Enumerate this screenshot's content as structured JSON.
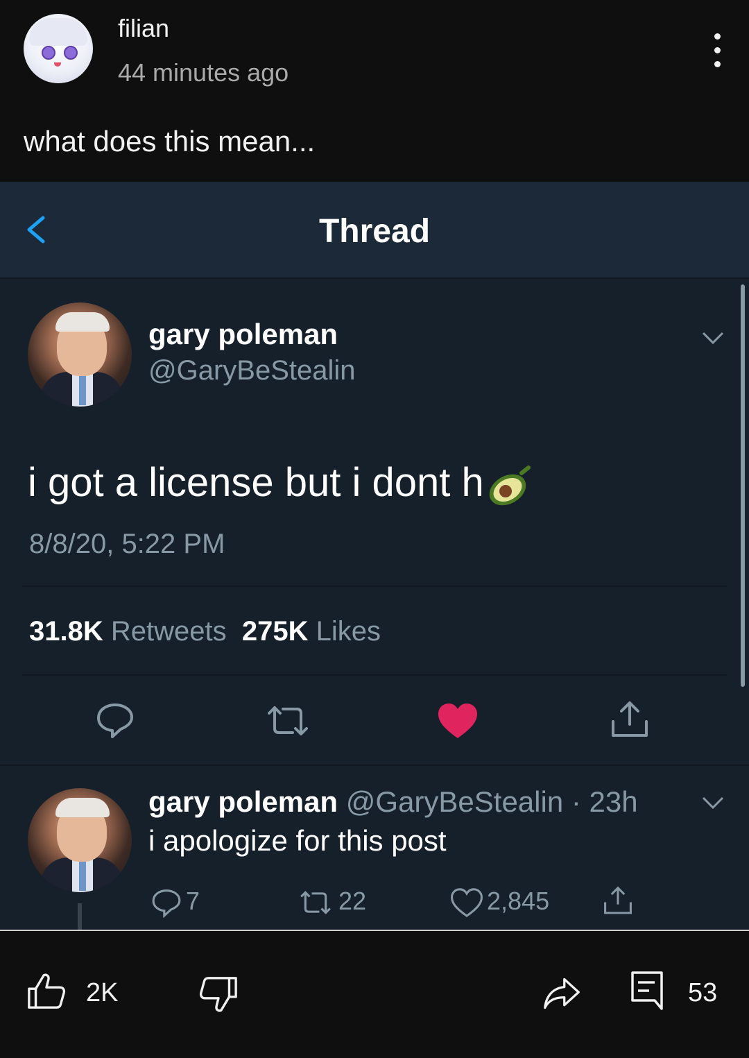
{
  "post": {
    "channel_name": "filian",
    "time_ago": "44 minutes ago",
    "text": "what does this mean..."
  },
  "thread": {
    "title": "Thread",
    "tweet": {
      "display_name": "gary poleman",
      "handle": "@GaryBeStealin",
      "text": "i got a license but i dont h",
      "timestamp": "8/8/20, 5:22 PM",
      "retweets_count": "31.8K",
      "retweets_label": "Retweets",
      "likes_count": "275K",
      "likes_label": "Likes",
      "liked": true
    },
    "reply": {
      "display_name": "gary poleman",
      "handle_time": "@GaryBeStealin · 23h",
      "text": "i apologize for this post",
      "replies": "7",
      "retweets": "22",
      "likes": "2,845"
    }
  },
  "actions": {
    "likes": "2K",
    "comments": "53"
  },
  "colors": {
    "twitter_bg": "#15202b",
    "twitter_topbar": "#1c2938",
    "twitter_secondary": "#8899a6",
    "like_red": "#e0245e",
    "accent_blue": "#1da1f2"
  }
}
